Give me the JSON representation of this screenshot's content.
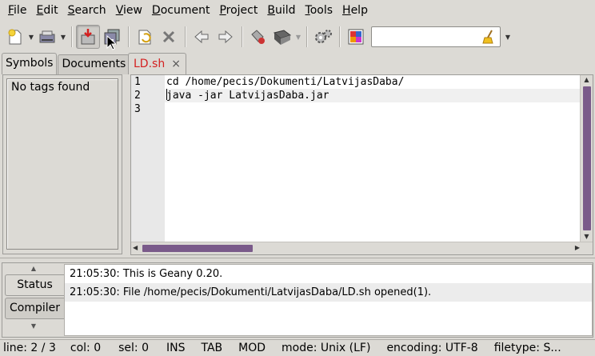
{
  "menu": [
    {
      "ul": "F",
      "rest": "ile"
    },
    {
      "ul": "E",
      "rest": "dit"
    },
    {
      "ul": "S",
      "rest": "earch"
    },
    {
      "ul": "V",
      "rest": "iew"
    },
    {
      "ul": "D",
      "rest": "ocument"
    },
    {
      "ul": "P",
      "rest": "roject"
    },
    {
      "ul": "B",
      "rest": "uild"
    },
    {
      "ul": "T",
      "rest": "ools"
    },
    {
      "ul": "H",
      "rest": "elp"
    }
  ],
  "toolbar": {
    "icons": [
      "new-file-icon",
      "open-file-icon",
      "save-icon",
      "save-all-icon",
      "revert-icon",
      "close-icon",
      "back-icon",
      "forward-icon",
      "compile-icon",
      "build-icon",
      "preferences-icon",
      "color-chooser-icon",
      "clear-search-icon"
    ],
    "search_value": ""
  },
  "sidebar": {
    "tabs": [
      "Symbols",
      "Documents"
    ],
    "active_tab": "Symbols",
    "empty_text": "No tags found"
  },
  "editor": {
    "tab": {
      "filename": "LD.sh",
      "close": "×"
    },
    "line_numbers": [
      "1",
      "2",
      "3"
    ],
    "lines": [
      "cd /home/pecis/Dokumenti/LatvijasDaba/",
      "java -jar LatvijasDaba.jar",
      ""
    ],
    "current_line": 2
  },
  "messages": {
    "tabs": [
      "Status",
      "Compiler"
    ],
    "active_tab": "Status",
    "items": [
      "21:05:30: This is Geany 0.20.",
      "21:05:30: File /home/pecis/Dokumenti/LatvijasDaba/LD.sh opened(1)."
    ]
  },
  "status": {
    "line": "line: 2 / 3",
    "col": "col: 0",
    "sel": "sel: 0",
    "ins": "INS",
    "tab": "TAB",
    "mod": "MOD",
    "mode": "mode: Unix (LF)",
    "encoding": "encoding: UTF-8",
    "filetype": "filetype: S..."
  },
  "colors": {
    "tab_filename": "#d42020",
    "scroll_thumb": "#7a5a8a"
  }
}
